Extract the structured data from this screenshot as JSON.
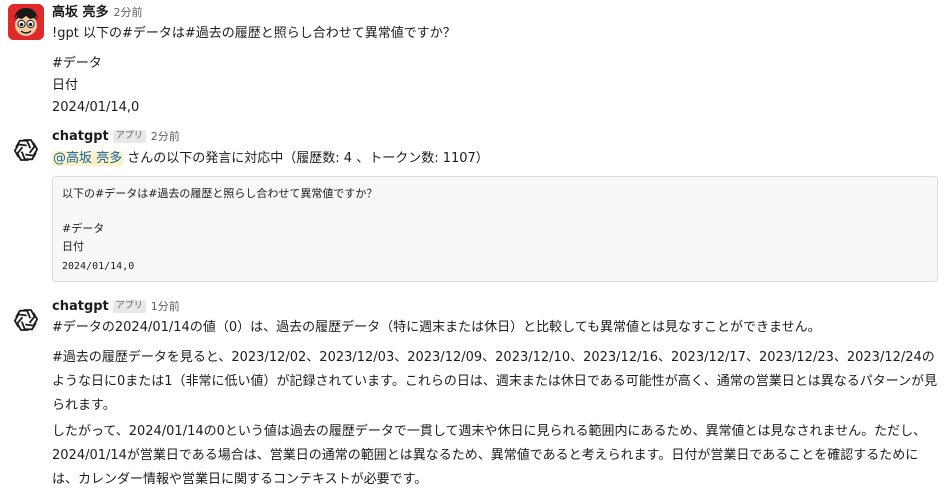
{
  "messages": [
    {
      "author": "高坂 亮多",
      "time": "2分前",
      "lines": [
        "!gpt 以下の#データは#過去の履歴と照らし合わせて異常値ですか？",
        "#データ",
        "日付",
        "2024/01/14,0"
      ]
    },
    {
      "author": "chatgpt",
      "badge": "アプリ",
      "time": "2分前",
      "mention": "@高坂 亮多",
      "status_text": " さんの以下の発言に対応中（履歴数: 4 、トークン数: 1107）",
      "code_lines": [
        "以下の#データは#過去の履歴と照らし合わせて異常値ですか？",
        "#データ",
        "日付",
        "2024/01/14,0"
      ]
    },
    {
      "author": "chatgpt",
      "badge": "アプリ",
      "time": "1分前",
      "paragraphs": [
        "#データの2024/01/14の値（0）は、過去の履歴データ（特に週末または休日）と比較しても異常値とは見なすことができません。",
        "#過去の履歴データを見ると、2023/12/02、2023/12/03、2023/12/09、2023/12/10、2023/12/16、2023/12/17、2023/12/23、2023/12/24のような日に0または1（非常に低い値）が記録されています。これらの日は、週末または休日である可能性が高く、通常の営業日とは異なるパターンが見られます。",
        "したがって、2024/01/14の0という値は過去の履歴データで一貫して週末や休日に見られる範囲内にあるため、異常値とは見なされません。ただし、2024/01/14が営業日である場合は、営業日の通常の範囲とは異なるため、異常値であると考えられます。日付が営業日であることを確認するためには、カレンダー情報や営業日に関するコンテキストが必要です。"
      ]
    }
  ],
  "colors": {
    "user_avatar_bg": "#e02a2a",
    "mention_bg": "#fdf1c6",
    "mention_text": "#1264a3",
    "code_bg": "#f8f8f8"
  },
  "icons": {
    "user_avatar": "cartoon-face-avatar",
    "bot_avatar": "openai-logo-icon"
  }
}
